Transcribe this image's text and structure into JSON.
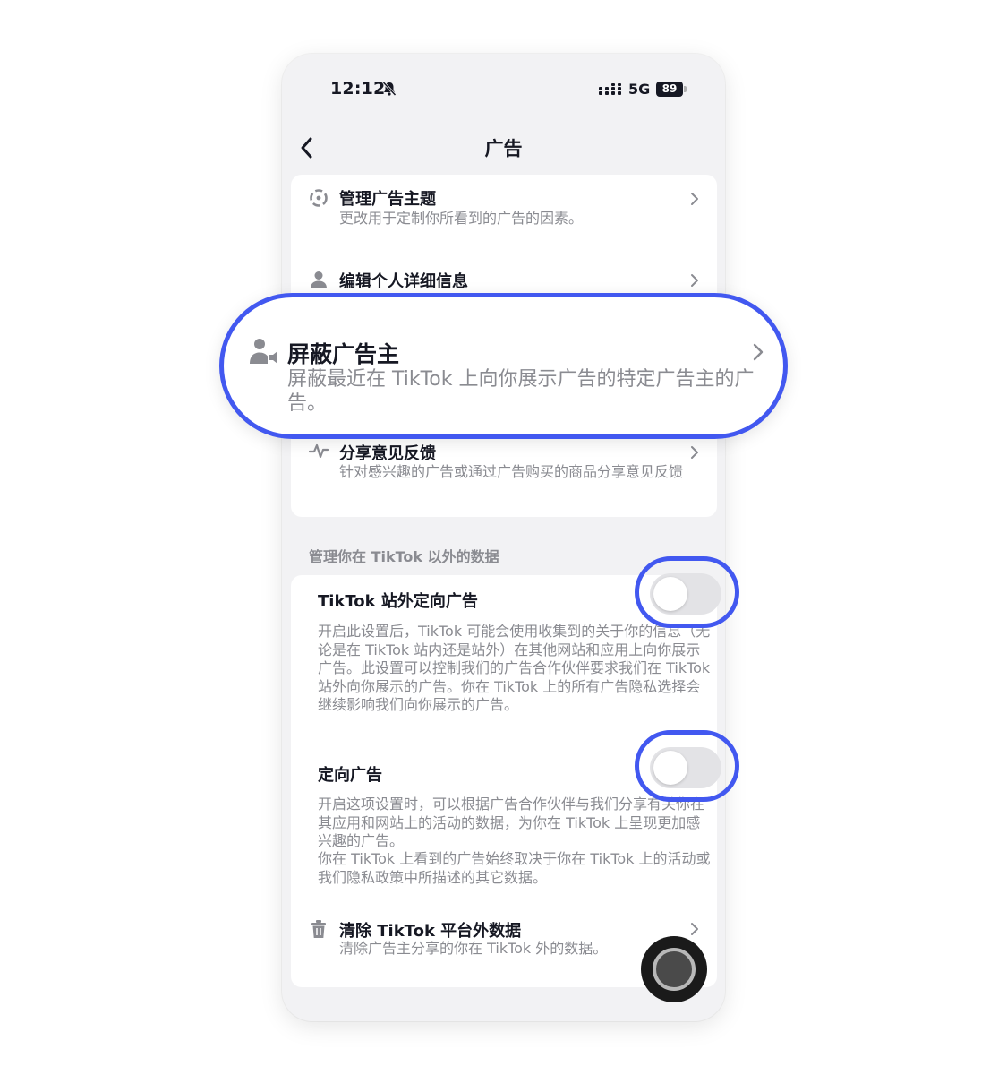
{
  "status_bar": {
    "time": "12:12",
    "network": "5G",
    "battery": "89",
    "icons": [
      "bell-muted-icon",
      "signal-icon"
    ]
  },
  "nav": {
    "title": "广告",
    "back_icon": "chevron-left-icon"
  },
  "menu_items": [
    {
      "title": "管理广告主题",
      "description": "更改用于定制你所看到的广告的因素。",
      "icon": "topics-icon"
    },
    {
      "title": "编辑个人详细信息",
      "description": "",
      "icon": "person-icon"
    },
    {
      "title": "分享意见反馈",
      "description": "针对感兴趣的广告或通过广告购买的商品分享意见反馈",
      "icon": "pulse-icon"
    }
  ],
  "callout": {
    "title": "屏蔽广告主",
    "description": "屏蔽最近在 TikTok 上向你展示广告的特定广告主的广告。",
    "icon": "block-advertiser-icon",
    "highlight_color": "#4258f0"
  },
  "section": {
    "header": "管理你在 TikTok 以外的数据"
  },
  "toggles": [
    {
      "title": "TikTok 站外定向广告",
      "description": "开启此设置后，TikTok 可能会使用收集到的关于你的信息（无论是在 TikTok 站内还是站外）在其他网站和应用上向你展示广告。此设置可以控制我们的广告合作伙伴要求我们在 TikTok 站外向你展示的广告。你在 TikTok 上的所有广告隐私选择会继续影响我们向你展示的广告。",
      "state": "off"
    },
    {
      "title": "定向广告",
      "description_1": "开启这项设置时，可以根据广告合作伙伴与我们分享有关你在其应用和网站上的活动的数据，为你在 TikTok 上呈现更加感兴趣的广告。",
      "description_2": "你在 TikTok 上看到的广告始终取决于你在 TikTok 上的活动或我们隐私政策中所描述的其它数据。",
      "state": "off"
    }
  ],
  "clear_data": {
    "title": "清除 TikTok 平台外数据",
    "description": "清除广告主分享的你在 TikTok 外的数据。",
    "icon": "trash-icon"
  },
  "colors": {
    "highlight": "#4258f0",
    "background": "#f2f2f4",
    "card": "#ffffff",
    "toggle_off": "#e3e3e6",
    "text_primary": "#161823",
    "text_secondary": "#8a8b91"
  }
}
